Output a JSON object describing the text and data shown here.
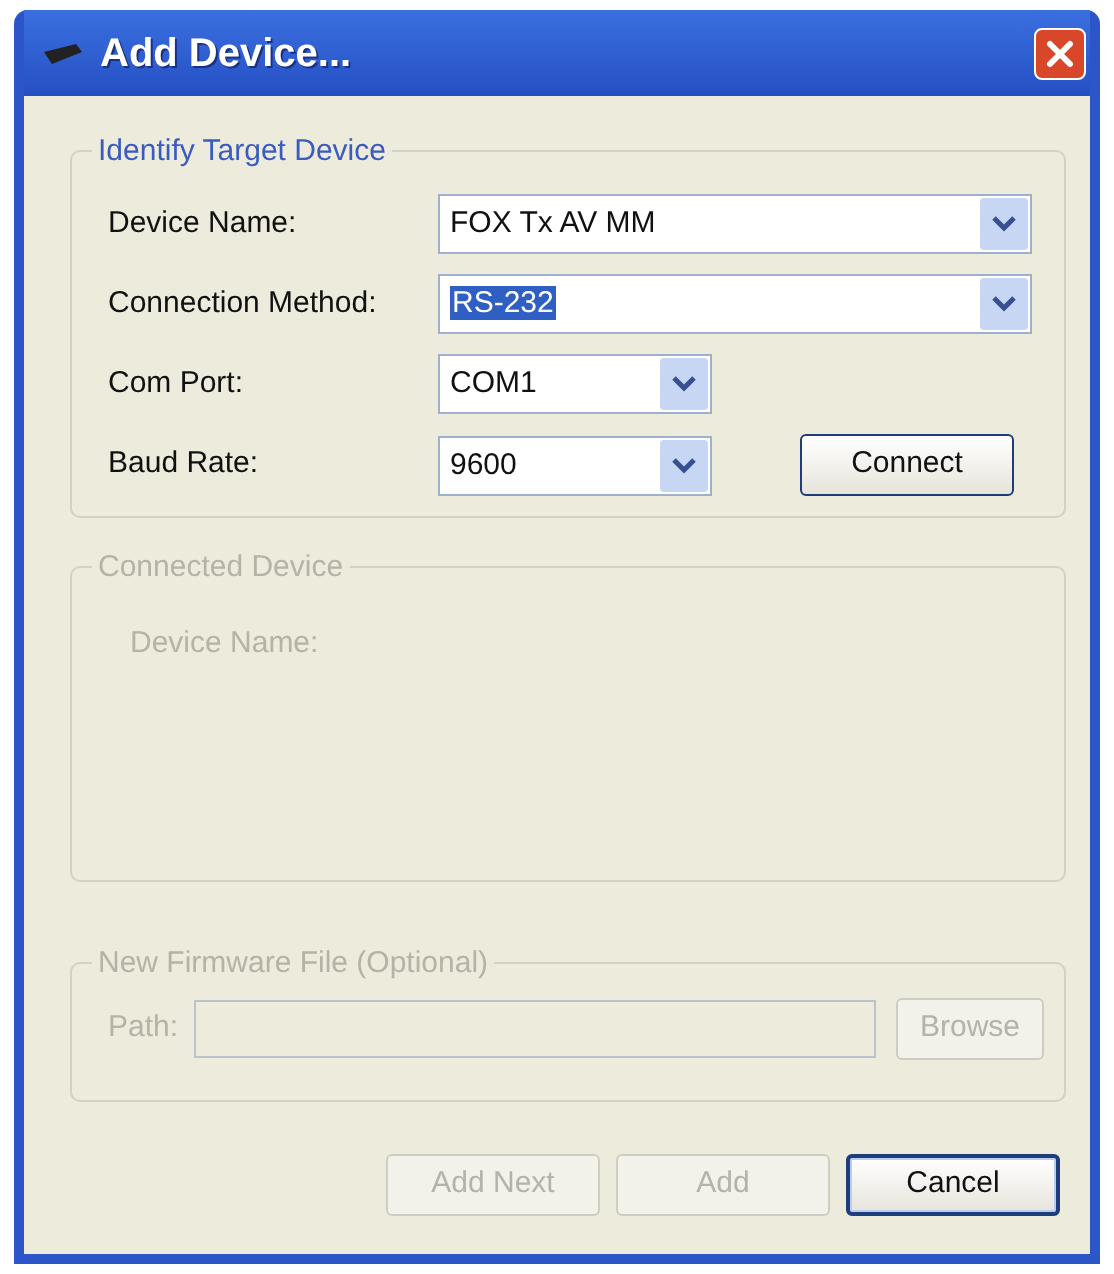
{
  "window": {
    "title": "Add Device..."
  },
  "identify": {
    "title": "Identify Target Device",
    "fields": [
      {
        "label": "Device Name:",
        "value": "FOX Tx AV MM",
        "kind": "wide",
        "highlighted": false
      },
      {
        "label": "Connection Method:",
        "value": "RS-232",
        "kind": "wide",
        "highlighted": true
      },
      {
        "label": "Com Port:",
        "value": "COM1",
        "kind": "narrow",
        "highlighted": false
      },
      {
        "label": "Baud Rate:",
        "value": "9600",
        "kind": "narrow",
        "highlighted": false
      }
    ],
    "connect_button": {
      "label": "Connect",
      "disabled": false
    }
  },
  "connected": {
    "title": "Connected Device",
    "disabled": true,
    "label": "Device Name:"
  },
  "firmware": {
    "title": "New Firmware File (Optional)",
    "disabled": true,
    "path_label": "Path:",
    "browse_button": {
      "label": "Browse",
      "disabled": true
    }
  },
  "buttons": [
    {
      "label": "Add Next",
      "disabled": true,
      "default": false
    },
    {
      "label": "Add",
      "disabled": true,
      "default": false
    },
    {
      "label": "Cancel",
      "disabled": false,
      "default": true
    }
  ]
}
